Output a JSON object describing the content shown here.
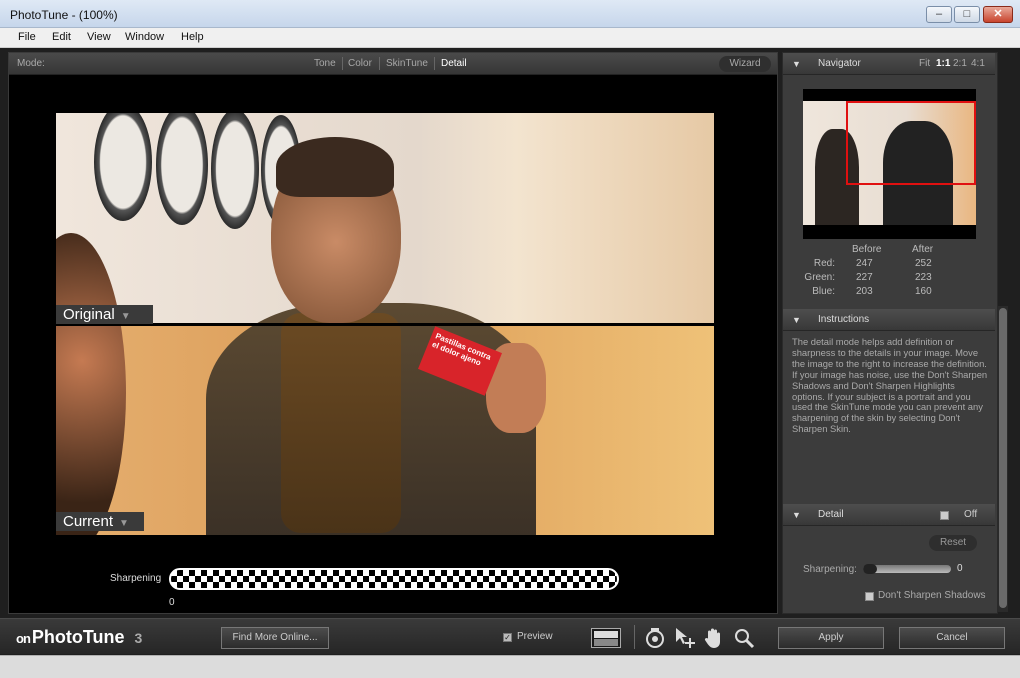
{
  "window": {
    "title": "PhotoTune -  (100%)",
    "min_glyph": "–",
    "max_glyph": "□",
    "close_glyph": "✕"
  },
  "menu": [
    "File",
    "Edit",
    "View",
    "Window",
    "Help"
  ],
  "modebar": {
    "label": "Mode:",
    "tabs": [
      "Tone",
      "Color",
      "SkinTune",
      "Detail"
    ],
    "active_tab": "Detail",
    "wizard": "Wizard"
  },
  "preview": {
    "original_label": "Original",
    "current_label": "Current",
    "card_text": "Pastillas contra el dolor ajeno",
    "sharpening_label": "Sharpening",
    "sharpening_value": "0"
  },
  "navigator": {
    "title": "Navigator",
    "zoom_options": [
      "Fit",
      "1:1",
      "2:1",
      "4:1"
    ],
    "active_zoom": "1:1",
    "headers": [
      "Before",
      "After"
    ],
    "rows": [
      {
        "label": "Red:",
        "before": "247",
        "after": "252"
      },
      {
        "label": "Green:",
        "before": "227",
        "after": "223"
      },
      {
        "label": "Blue:",
        "before": "203",
        "after": "160"
      }
    ]
  },
  "instructions": {
    "title": "Instructions",
    "text": "The detail mode helps add definition or sharpness to the details in your image. Move the image to the right to increase the definition. If your image has noise, use the Don't Sharpen Shadows and Don't Sharpen Highlights options. If your subject is a portrait and you used the SkinTune mode you can prevent any sharpening of the skin by selecting Don't Sharpen Skin."
  },
  "detail": {
    "title": "Detail",
    "off_label": "Off",
    "reset": "Reset",
    "sharpening_label": "Sharpening:",
    "sharpening_value": "0",
    "dont_sharpen_shadows": "Don't Sharpen Shadows"
  },
  "bottombar": {
    "logo_on": "on",
    "logo_name": "PhotoTune",
    "logo_version": "3",
    "find_more": "Find More Online...",
    "preview_label": "Preview",
    "preview_checked": true,
    "apply": "Apply",
    "cancel": "Cancel"
  }
}
